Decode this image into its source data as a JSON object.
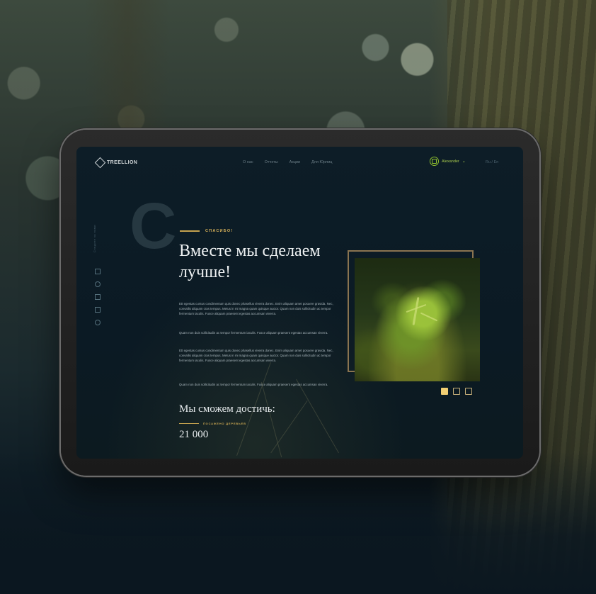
{
  "brand": {
    "name": "TREELLION"
  },
  "nav": {
    "items": [
      "О нас",
      "Отчеты",
      "Акции",
      "Для Юрлиц"
    ]
  },
  "user": {
    "name": "Alexander",
    "chevron": "⌄"
  },
  "lang": "Ru / En",
  "sidebar": {
    "label": "Следите за нами",
    "icons": [
      "instagram-icon",
      "vk-icon",
      "facebook-icon",
      "linkedin-icon",
      "telegram-icon"
    ]
  },
  "hero": {
    "big_letter": "С",
    "eyebrow": "СПАСИБО!",
    "headline": "Вместе мы сделаем лучше!",
    "paragraphs": [
      "Ett egestas cursus condimentum quis donec phasellus viverra donec. Enim aliquam amet posuere gravida. Nec, convallis aliquam cras tempus. Metus in mi magna quam quisque auctor. Quam non duis sollicitudin ac tempor fermentum iaculis. Fusce aliquam praesent egestas accumsan viverra.",
      "Quam non duis sollicitudin ac tempor fermentum iaculis. Fusce aliquam praesent egestas accumsan viverra.",
      "Ett egestas cursus condimentum quis donec phasellus viverra donec. Enim aliquam amet posuere gravida. Nec, convallis aliquam cras tempus. Metus in mi magna quam quisque auctor. Quam non duis sollicitudin ac tempor fermentum iaculis. Fusce aliquam praesent egestas accumsan viverra.",
      "Quam non duis sollicitudin ac tempor fermentum iaculis. Fusce aliquam praesent egestas accumsan viverra."
    ],
    "subhead": "Мы сможем достичь:",
    "metric_label": "ПОСАЖЕНО ДЕРЕВЬЕВ",
    "metric_value": "21 000"
  },
  "slider": {
    "count": 3,
    "active_index": 0
  },
  "colors": {
    "accent_gold": "#d8b25a",
    "accent_green": "#8fbf2e",
    "screen_bg": "#0b1a24"
  }
}
